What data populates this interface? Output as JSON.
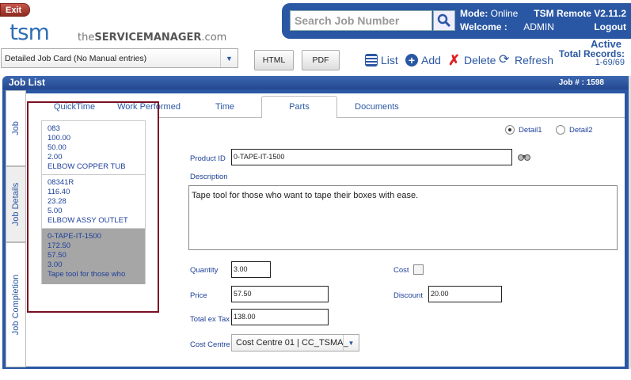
{
  "app": {
    "exit_label": "Exit",
    "logo": "tsm",
    "logo_sub_prefix": "the",
    "logo_sub_main": "SERVICEMANAGER",
    "logo_sub_suffix": ".com"
  },
  "search": {
    "placeholder": "Search Job Number"
  },
  "status": {
    "mode_label": "Mode:",
    "mode_value": "Online",
    "app_version": "TSM Remote V2.11.2",
    "welcome_label": "Welcome :",
    "user": "ADMIN",
    "logout": "Logout",
    "active": "Active",
    "total_label": "Total Records:",
    "total_value": "1-69/69"
  },
  "toolbar": {
    "job_card": "Detailed Job Card (No Manual entries)",
    "html": "HTML",
    "pdf": "PDF",
    "list": "List",
    "add": "Add",
    "delete": "Delete",
    "refresh": "Refresh"
  },
  "header": {
    "title": "Job List",
    "job_no": "Job # :  1598"
  },
  "side_tabs": [
    "Job",
    "Job Details",
    "Job Completion"
  ],
  "tabs": [
    "QuickTime",
    "Work Performed",
    "Time",
    "Parts",
    "Documents"
  ],
  "parts_list": [
    {
      "lines": [
        "083",
        "100.00",
        "50.00",
        "2.00",
        "ELBOW COPPER TUB"
      ]
    },
    {
      "lines": [
        "08341R",
        "116.40",
        "23.28",
        "5.00",
        "ELBOW ASSY OUTLET"
      ]
    },
    {
      "lines": [
        "0-TAPE-IT-1500",
        "172.50",
        "57.50",
        "3.00",
        "Tape tool for those who"
      ]
    }
  ],
  "detail": {
    "detail1": "Detail1",
    "detail2": "Detail2",
    "product_id_label": "Product ID",
    "product_id": "0-TAPE-IT-1500",
    "description_label": "Description",
    "description": "Tape tool for those who want to tape their boxes with ease.",
    "quantity_label": "Quantity",
    "quantity": "3.00",
    "cost_label": "Cost",
    "price_label": "Price",
    "price": "57.50",
    "discount_label": "Discount",
    "discount": "20.00",
    "total_label": "Total ex Tax",
    "total": "138.00",
    "cost_centre_label": "Cost Centre",
    "cost_centre": "Cost Centre 01 | CC_TSMA_"
  },
  "colors": {
    "brand": "#2a57a3",
    "highlight": "#7a1022"
  }
}
